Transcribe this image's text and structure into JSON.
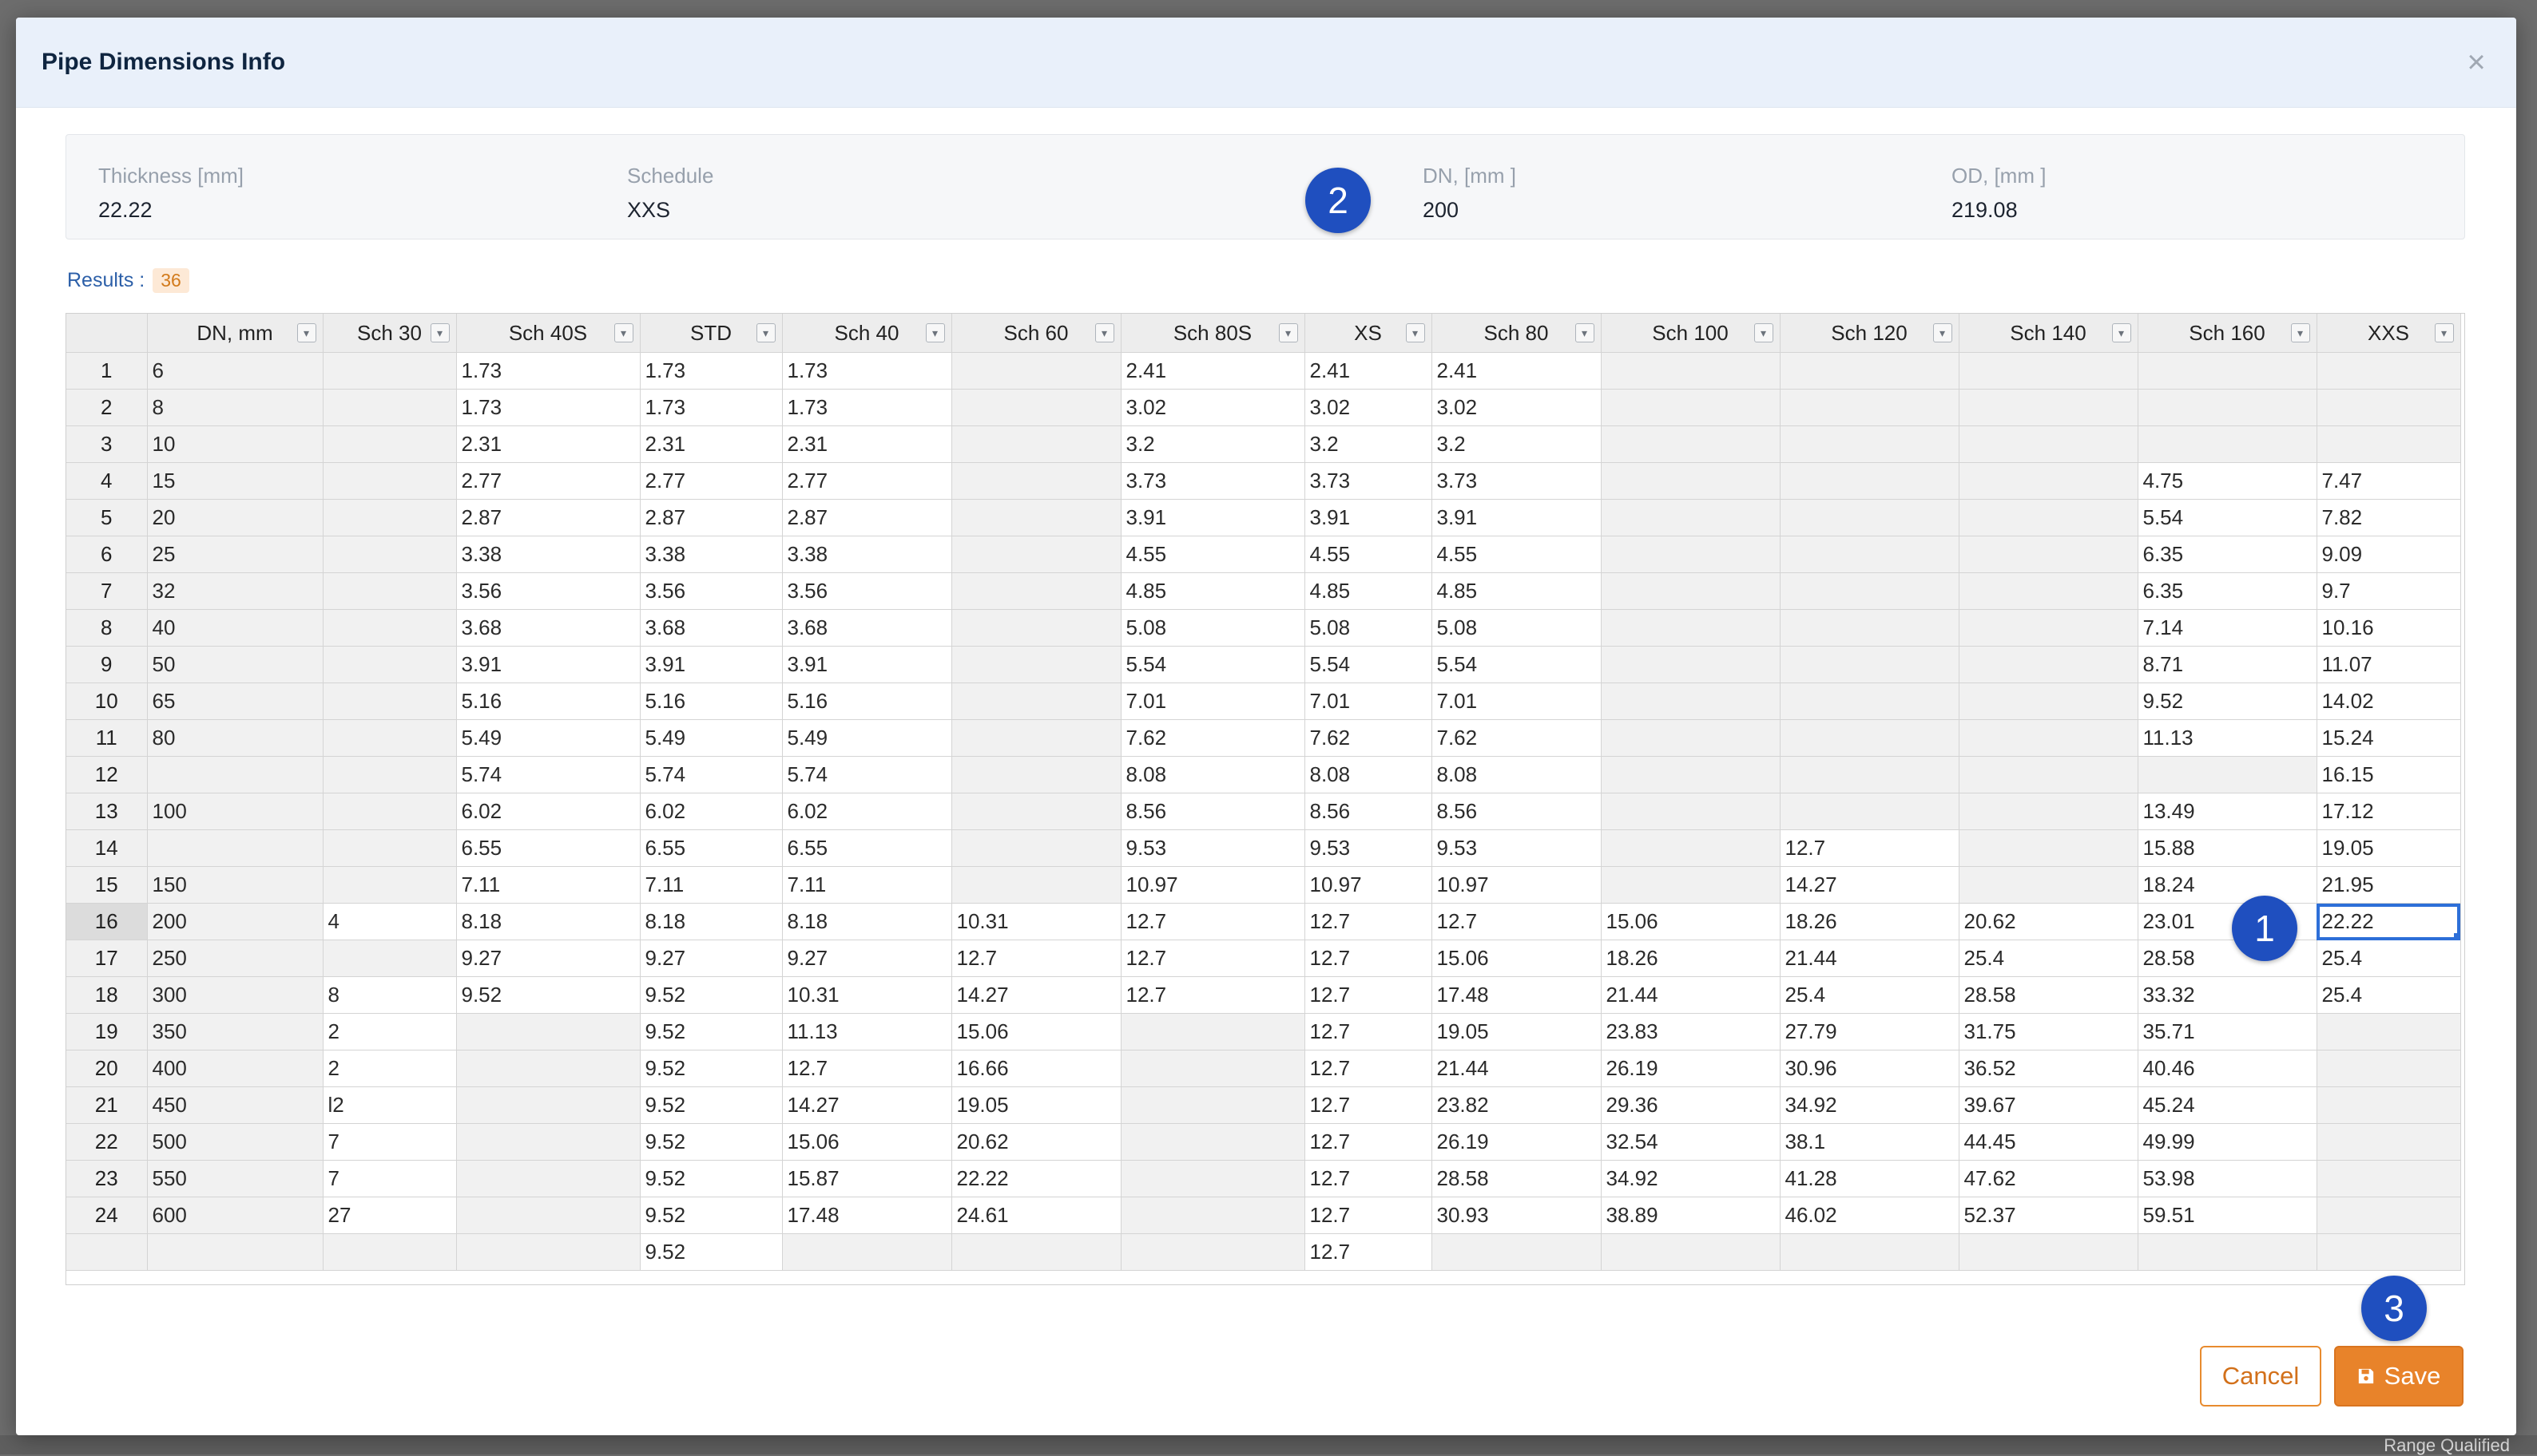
{
  "modal": {
    "title": "Pipe Dimensions Info",
    "close_glyph": "×",
    "close_icon": "close-icon"
  },
  "info": [
    {
      "label": "Thickness [mm]",
      "value": "22.22"
    },
    {
      "label": "Schedule",
      "value": "XXS"
    },
    {
      "label": "DN, [mm ]",
      "value": "200"
    },
    {
      "label": "OD, [mm ]",
      "value": "219.08"
    }
  ],
  "results": {
    "label": "Results :",
    "count": "36"
  },
  "annotations": [
    "1",
    "2",
    "3"
  ],
  "grid": {
    "columns": [
      "DN, mm",
      "Sch 30",
      "Sch 40S",
      "STD",
      "Sch 40",
      "Sch 60",
      "Sch 80S",
      "XS",
      "Sch 80",
      "Sch 100",
      "Sch 120",
      "Sch 140",
      "Sch 160",
      "XXS"
    ],
    "selected_row": 16,
    "selected_col": 13,
    "rows": [
      [
        "1",
        "6",
        "",
        "1.73",
        "1.73",
        "1.73",
        "",
        "2.41",
        "2.41",
        "2.41",
        "",
        "",
        "",
        "",
        ""
      ],
      [
        "2",
        "8",
        "",
        "1.73",
        "1.73",
        "1.73",
        "",
        "3.02",
        "3.02",
        "3.02",
        "",
        "",
        "",
        "",
        ""
      ],
      [
        "3",
        "10",
        "",
        "2.31",
        "2.31",
        "2.31",
        "",
        "3.2",
        "3.2",
        "3.2",
        "",
        "",
        "",
        "",
        ""
      ],
      [
        "4",
        "15",
        "",
        "2.77",
        "2.77",
        "2.77",
        "",
        "3.73",
        "3.73",
        "3.73",
        "",
        "",
        "",
        "4.75",
        "7.47"
      ],
      [
        "5",
        "20",
        "",
        "2.87",
        "2.87",
        "2.87",
        "",
        "3.91",
        "3.91",
        "3.91",
        "",
        "",
        "",
        "5.54",
        "7.82"
      ],
      [
        "6",
        "25",
        "",
        "3.38",
        "3.38",
        "3.38",
        "",
        "4.55",
        "4.55",
        "4.55",
        "",
        "",
        "",
        "6.35",
        "9.09"
      ],
      [
        "7",
        "32",
        "",
        "3.56",
        "3.56",
        "3.56",
        "",
        "4.85",
        "4.85",
        "4.85",
        "",
        "",
        "",
        "6.35",
        "9.7"
      ],
      [
        "8",
        "40",
        "",
        "3.68",
        "3.68",
        "3.68",
        "",
        "5.08",
        "5.08",
        "5.08",
        "",
        "",
        "",
        "7.14",
        "10.16"
      ],
      [
        "9",
        "50",
        "",
        "3.91",
        "3.91",
        "3.91",
        "",
        "5.54",
        "5.54",
        "5.54",
        "",
        "",
        "",
        "8.71",
        "11.07"
      ],
      [
        "10",
        "65",
        "",
        "5.16",
        "5.16",
        "5.16",
        "",
        "7.01",
        "7.01",
        "7.01",
        "",
        "",
        "",
        "9.52",
        "14.02"
      ],
      [
        "11",
        "80",
        "",
        "5.49",
        "5.49",
        "5.49",
        "",
        "7.62",
        "7.62",
        "7.62",
        "",
        "",
        "",
        "11.13",
        "15.24"
      ],
      [
        "12",
        "",
        "",
        "5.74",
        "5.74",
        "5.74",
        "",
        "8.08",
        "8.08",
        "8.08",
        "",
        "",
        "",
        "",
        "16.15"
      ],
      [
        "13",
        "100",
        "",
        "6.02",
        "6.02",
        "6.02",
        "",
        "8.56",
        "8.56",
        "8.56",
        "",
        "",
        "",
        "13.49",
        "17.12"
      ],
      [
        "14",
        "",
        "",
        "6.55",
        "6.55",
        "6.55",
        "",
        "9.53",
        "9.53",
        "9.53",
        "",
        "12.7",
        "",
        "15.88",
        "19.05"
      ],
      [
        "15",
        "150",
        "",
        "7.11",
        "7.11",
        "7.11",
        "",
        "10.97",
        "10.97",
        "10.97",
        "",
        "14.27",
        "",
        "18.24",
        "21.95"
      ],
      [
        "16",
        "200",
        "4",
        "8.18",
        "8.18",
        "8.18",
        "10.31",
        "12.7",
        "12.7",
        "12.7",
        "15.06",
        "18.26",
        "20.62",
        "23.01",
        "22.22"
      ],
      [
        "17",
        "250",
        "",
        "9.27",
        "9.27",
        "9.27",
        "12.7",
        "12.7",
        "12.7",
        "15.06",
        "18.26",
        "21.44",
        "25.4",
        "28.58",
        "25.4"
      ],
      [
        "18",
        "300",
        "8",
        "9.52",
        "9.52",
        "10.31",
        "14.27",
        "12.7",
        "12.7",
        "17.48",
        "21.44",
        "25.4",
        "28.58",
        "33.32",
        "25.4"
      ],
      [
        "19",
        "350",
        "2",
        "",
        "9.52",
        "11.13",
        "15.06",
        "",
        "12.7",
        "19.05",
        "23.83",
        "27.79",
        "31.75",
        "35.71",
        ""
      ],
      [
        "20",
        "400",
        "2",
        "",
        "9.52",
        "12.7",
        "16.66",
        "",
        "12.7",
        "21.44",
        "26.19",
        "30.96",
        "36.52",
        "40.46",
        ""
      ],
      [
        "21",
        "450",
        "l2",
        "",
        "9.52",
        "14.27",
        "19.05",
        "",
        "12.7",
        "23.82",
        "29.36",
        "34.92",
        "39.67",
        "45.24",
        ""
      ],
      [
        "22",
        "500",
        "7",
        "",
        "9.52",
        "15.06",
        "20.62",
        "",
        "12.7",
        "26.19",
        "32.54",
        "38.1",
        "44.45",
        "49.99",
        ""
      ],
      [
        "23",
        "550",
        "7",
        "",
        "9.52",
        "15.87",
        "22.22",
        "",
        "12.7",
        "28.58",
        "34.92",
        "41.28",
        "47.62",
        "53.98",
        ""
      ],
      [
        "24",
        "600",
        "27",
        "",
        "9.52",
        "17.48",
        "24.61",
        "",
        "12.7",
        "30.93",
        "38.89",
        "46.02",
        "52.37",
        "59.51",
        ""
      ],
      [
        "",
        "",
        "",
        "",
        "9.52",
        "",
        "",
        "",
        "12.7",
        "",
        "",
        "",
        "",
        "",
        ""
      ]
    ]
  },
  "buttons": {
    "cancel": "Cancel",
    "save": "Save"
  },
  "backdrop": {
    "footer_text": "Range Qualified"
  },
  "colors": {
    "accent": "#e8832a",
    "primary": "#1f4fbf",
    "selection": "#2d6fd8"
  }
}
